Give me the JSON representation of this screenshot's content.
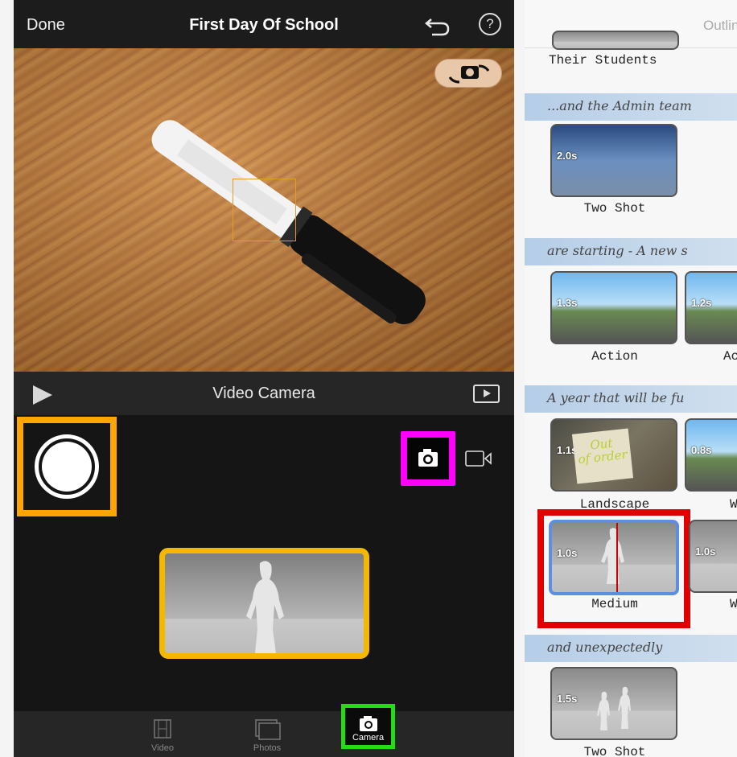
{
  "header": {
    "done_label": "Done",
    "title": "First Day Of School",
    "undo_icon": "undo-icon",
    "help_label": "?"
  },
  "viewfinder": {
    "flip_icon": "camera-flip-icon"
  },
  "camera_bar": {
    "play_icon": "play-icon",
    "label": "Video Camera",
    "preview_icon": "preview-icon"
  },
  "modes": {
    "photo_icon": "camera-icon",
    "video_icon": "video-camera-icon"
  },
  "tabs": [
    {
      "label": "Video",
      "icon": "film-icon"
    },
    {
      "label": "Photos",
      "icon": "photos-icon"
    },
    {
      "label": "Camera",
      "icon": "camera-icon",
      "selected": true
    }
  ],
  "outline": {
    "header_label": "Outline",
    "items": [
      {
        "caption": "",
        "shot": "Their Students"
      },
      {
        "caption": "...and the Admin team",
        "thumbs": [
          {
            "dur": "2.0s",
            "label": "Two Shot"
          }
        ]
      },
      {
        "caption": "are starting - A new s",
        "thumbs": [
          {
            "dur": "1.3s",
            "label": "Action"
          },
          {
            "dur": "1.2s",
            "label": "Ac"
          }
        ]
      },
      {
        "caption": "A year that will be fu",
        "thumbs": [
          {
            "dur": "1.1s",
            "label": "Landscape"
          },
          {
            "dur": "0.8s",
            "label": "W"
          }
        ]
      },
      {
        "caption": "",
        "thumbs": [
          {
            "dur": "1.0s",
            "label": "Medium",
            "selected": true
          },
          {
            "dur": "1.0s",
            "label": "W"
          }
        ]
      },
      {
        "caption": "and unexpectedly",
        "thumbs": [
          {
            "dur": "1.5s",
            "label": "Two Shot"
          }
        ]
      }
    ],
    "sign_text": [
      "Out",
      "of order"
    ]
  },
  "colors": {
    "highlight_orange": "#ffa500",
    "highlight_magenta": "#ff00ff",
    "highlight_yellow": "#f5b800",
    "highlight_green": "#22dd11",
    "highlight_red": "#e00000",
    "selected_blue": "#5d8ee0"
  }
}
